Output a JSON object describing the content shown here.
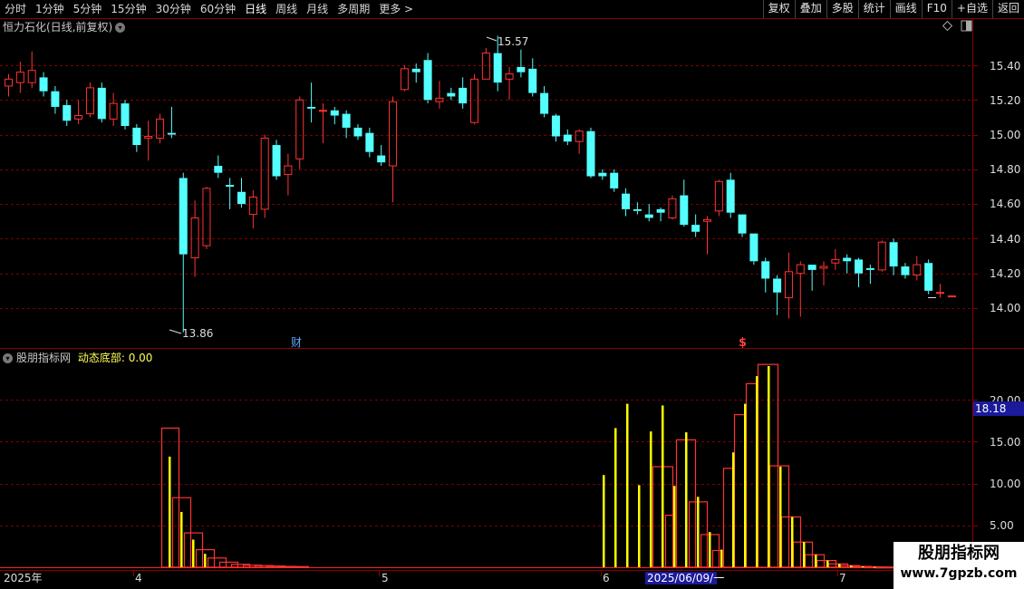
{
  "toolbar": {
    "periods": [
      "分时",
      "1分钟",
      "5分钟",
      "15分钟",
      "30分钟",
      "60分钟",
      "日线",
      "周线",
      "月线",
      "多周期",
      "更多 >"
    ],
    "active_period": "日线",
    "actions": [
      "复权",
      "叠加",
      "多股",
      "统计",
      "画线",
      "F10",
      "+自选",
      "返回"
    ]
  },
  "main_panel": {
    "title": "恒力石化(日线,前复权)",
    "y_ticks": [
      "15.40",
      "15.20",
      "15.00",
      "14.80",
      "14.60",
      "14.40",
      "14.20",
      "14.00"
    ],
    "high_label": "15.57",
    "low_label": "13.86",
    "marker_cai": "财",
    "marker_s": "$"
  },
  "sub_panel": {
    "title": "股朋指标网",
    "indicator_label": "动态底部: 0.00",
    "y_ticks": [
      "20.00",
      "15.00",
      "10.00",
      "5.00"
    ],
    "current_value": "18.18"
  },
  "date_axis": {
    "labels": [
      "2025年",
      "4",
      "5",
      "6",
      "7"
    ],
    "cursor_date": "2025/06/09/一"
  },
  "watermark": {
    "line1": "股朋指标网",
    "line2": "www.7gpzb.com"
  },
  "colors": {
    "up": "#ff3232",
    "down": "#54ffff",
    "yellow_bar": "#ffff00",
    "grid": "#7a0000",
    "axis_text": "#dddddd"
  },
  "chart_data": {
    "type": "candlestick",
    "price_range": [
      13.8,
      15.6
    ],
    "candles": [
      [
        15.28,
        15.32,
        15.35,
        15.22
      ],
      [
        15.3,
        15.36,
        15.42,
        15.24
      ],
      [
        15.3,
        15.37,
        15.48,
        15.27
      ],
      [
        15.33,
        15.25,
        15.36,
        15.22
      ],
      [
        15.25,
        15.16,
        15.28,
        15.12
      ],
      [
        15.17,
        15.08,
        15.2,
        15.05
      ],
      [
        15.09,
        15.11,
        15.2,
        15.06
      ],
      [
        15.12,
        15.27,
        15.3,
        15.1
      ],
      [
        15.27,
        15.09,
        15.3,
        15.07
      ],
      [
        15.09,
        15.18,
        15.24,
        15.05
      ],
      [
        15.18,
        15.05,
        15.2,
        15.03
      ],
      [
        15.04,
        14.94,
        15.06,
        14.9
      ],
      [
        14.98,
        14.99,
        15.08,
        14.85
      ],
      [
        14.98,
        15.09,
        15.12,
        14.95
      ],
      [
        15.01,
        15.0,
        15.16,
        14.98
      ],
      [
        14.75,
        14.31,
        14.78,
        13.86
      ],
      [
        14.29,
        14.52,
        14.62,
        14.18
      ],
      [
        14.36,
        14.69,
        14.7,
        14.34
      ],
      [
        14.82,
        14.78,
        14.88,
        14.75
      ],
      [
        14.71,
        14.7,
        14.75,
        14.57
      ],
      [
        14.67,
        14.6,
        14.75,
        14.58
      ],
      [
        14.54,
        14.64,
        14.68,
        14.46
      ],
      [
        14.57,
        14.98,
        15.0,
        14.52
      ],
      [
        14.94,
        14.76,
        14.97,
        14.74
      ],
      [
        14.77,
        14.82,
        14.89,
        14.65
      ],
      [
        14.86,
        15.2,
        15.22,
        14.8
      ],
      [
        15.16,
        15.15,
        15.3,
        15.07
      ],
      [
        15.14,
        15.14,
        15.18,
        14.95
      ],
      [
        15.14,
        15.11,
        15.16,
        15.06
      ],
      [
        15.12,
        15.04,
        15.14,
        14.98
      ],
      [
        15.04,
        14.99,
        15.06,
        14.97
      ],
      [
        15.01,
        14.9,
        15.04,
        14.87
      ],
      [
        14.88,
        14.84,
        14.94,
        14.82
      ],
      [
        14.82,
        15.19,
        15.22,
        14.61
      ],
      [
        15.26,
        15.38,
        15.4,
        15.25
      ],
      [
        15.38,
        15.36,
        15.41,
        15.3
      ],
      [
        15.43,
        15.2,
        15.47,
        15.18
      ],
      [
        15.19,
        15.21,
        15.31,
        15.15
      ],
      [
        15.24,
        15.22,
        15.27,
        15.2
      ],
      [
        15.27,
        15.18,
        15.33,
        15.15
      ],
      [
        15.07,
        15.32,
        15.35,
        15.06
      ],
      [
        15.32,
        15.47,
        15.5,
        15.32
      ],
      [
        15.47,
        15.3,
        15.57,
        15.25
      ],
      [
        15.32,
        15.35,
        15.39,
        15.2
      ],
      [
        15.39,
        15.36,
        15.49,
        15.33
      ],
      [
        15.38,
        15.24,
        15.44,
        15.22
      ],
      [
        15.24,
        15.12,
        15.28,
        15.1
      ],
      [
        15.11,
        14.99,
        15.12,
        14.96
      ],
      [
        15.0,
        14.96,
        15.03,
        14.94
      ],
      [
        14.96,
        15.02,
        15.03,
        14.89
      ],
      [
        15.02,
        14.76,
        15.04,
        14.75
      ],
      [
        14.78,
        14.76,
        14.8,
        14.74
      ],
      [
        14.78,
        14.69,
        14.8,
        14.67
      ],
      [
        14.66,
        14.57,
        14.69,
        14.53
      ],
      [
        14.57,
        14.56,
        14.61,
        14.54
      ],
      [
        14.54,
        14.52,
        14.6,
        14.5
      ],
      [
        14.57,
        14.55,
        14.58,
        14.5
      ],
      [
        14.52,
        14.63,
        14.65,
        14.51
      ],
      [
        14.65,
        14.48,
        14.74,
        14.47
      ],
      [
        14.48,
        14.44,
        14.54,
        14.41
      ],
      [
        14.5,
        14.51,
        14.53,
        14.31
      ],
      [
        14.56,
        14.73,
        14.74,
        14.53
      ],
      [
        14.74,
        14.55,
        14.78,
        14.52
      ],
      [
        14.54,
        14.43,
        14.54,
        14.41
      ],
      [
        14.43,
        14.27,
        14.43,
        14.25
      ],
      [
        14.27,
        14.17,
        14.29,
        14.09
      ],
      [
        14.17,
        14.09,
        14.19,
        13.96
      ],
      [
        14.06,
        14.21,
        14.32,
        13.94
      ],
      [
        14.2,
        14.25,
        14.27,
        13.95
      ],
      [
        14.25,
        14.22,
        14.25,
        14.1
      ],
      [
        14.23,
        14.24,
        14.27,
        14.13
      ],
      [
        14.26,
        14.28,
        14.34,
        14.22
      ],
      [
        14.29,
        14.27,
        14.31,
        14.2
      ],
      [
        14.28,
        14.2,
        14.29,
        14.12
      ],
      [
        14.23,
        14.22,
        14.25,
        14.14
      ],
      [
        14.22,
        14.38,
        14.39,
        14.21
      ],
      [
        14.38,
        14.24,
        14.4,
        14.19
      ],
      [
        14.24,
        14.19,
        14.26,
        14.17
      ],
      [
        14.19,
        14.25,
        14.3,
        14.16
      ],
      [
        14.26,
        14.1,
        14.28,
        14.08
      ],
      [
        14.09,
        14.09,
        14.14,
        14.06
      ],
      [
        14.07,
        14.07,
        14.07,
        14.07
      ]
    ],
    "sub_range": [
      0,
      25
    ],
    "boxes": [
      {
        "x0": 178,
        "x1": 197,
        "v": 16.6
      },
      {
        "x0": 190,
        "x1": 210,
        "v": 8.3
      },
      {
        "x0": 203,
        "x1": 223,
        "v": 4.1
      },
      {
        "x0": 216,
        "x1": 236,
        "v": 2.1
      },
      {
        "x0": 229,
        "x1": 249,
        "v": 1.1
      },
      {
        "x0": 242,
        "x1": 262,
        "v": 0.6
      },
      {
        "x0": 255,
        "x1": 275,
        "v": 0.35
      },
      {
        "x0": 268,
        "x1": 288,
        "v": 0.25
      },
      {
        "x0": 281,
        "x1": 301,
        "v": 0.2
      },
      {
        "x0": 294,
        "x1": 314,
        "v": 0.15
      },
      {
        "x0": 307,
        "x1": 327,
        "v": 0.1
      },
      {
        "x0": 320,
        "x1": 340,
        "v": 0.08
      },
      {
        "x0": 720,
        "x1": 742,
        "v": 12.0
      },
      {
        "x0": 734,
        "x1": 744,
        "v": 6.2
      },
      {
        "x0": 746,
        "x1": 767,
        "v": 15.2
      },
      {
        "x0": 760,
        "x1": 780,
        "v": 7.8
      },
      {
        "x0": 773,
        "x1": 793,
        "v": 3.9
      },
      {
        "x0": 786,
        "x1": 796,
        "v": 2.0
      },
      {
        "x0": 798,
        "x1": 808,
        "v": 11.8
      },
      {
        "x0": 810,
        "x1": 822,
        "v": 18.2
      },
      {
        "x0": 823,
        "x1": 835,
        "v": 21.9
      },
      {
        "x0": 836,
        "x1": 858,
        "v": 24.2
      },
      {
        "x0": 849,
        "x1": 870,
        "v": 12.1
      },
      {
        "x0": 862,
        "x1": 883,
        "v": 6.0
      },
      {
        "x0": 875,
        "x1": 896,
        "v": 3.0
      },
      {
        "x0": 888,
        "x1": 909,
        "v": 1.5
      },
      {
        "x0": 901,
        "x1": 922,
        "v": 0.8
      },
      {
        "x0": 914,
        "x1": 935,
        "v": 0.4
      },
      {
        "x0": 927,
        "x1": 948,
        "v": 0.2
      },
      {
        "x0": 940,
        "x1": 961,
        "v": 0.1
      },
      {
        "x0": 953,
        "x1": 974,
        "v": 0.05
      },
      {
        "x0": 966,
        "x1": 987,
        "v": 0.03
      }
    ],
    "ybars": [
      {
        "x": 187,
        "v": 13.2
      },
      {
        "x": 200,
        "v": 6.6
      },
      {
        "x": 213,
        "v": 3.3
      },
      {
        "x": 226,
        "v": 1.6
      },
      {
        "x": 666,
        "v": 11.0
      },
      {
        "x": 679,
        "v": 16.6
      },
      {
        "x": 692,
        "v": 19.5
      },
      {
        "x": 705,
        "v": 9.8
      },
      {
        "x": 718,
        "v": 16.2
      },
      {
        "x": 731,
        "v": 19.3
      },
      {
        "x": 744,
        "v": 9.7
      },
      {
        "x": 757,
        "v": 16.1
      },
      {
        "x": 770,
        "v": 8.4
      },
      {
        "x": 783,
        "v": 4.2
      },
      {
        "x": 796,
        "v": 2.1
      },
      {
        "x": 809,
        "v": 13.7
      },
      {
        "x": 822,
        "v": 19.5
      },
      {
        "x": 835,
        "v": 22.8
      },
      {
        "x": 848,
        "v": 24.0
      },
      {
        "x": 861,
        "v": 12.0
      },
      {
        "x": 874,
        "v": 6.0
      },
      {
        "x": 887,
        "v": 3.0
      },
      {
        "x": 900,
        "v": 1.5
      },
      {
        "x": 913,
        "v": 0.8
      },
      {
        "x": 926,
        "v": 0.4
      },
      {
        "x": 939,
        "v": 0.2
      },
      {
        "x": 952,
        "v": 0.1
      },
      {
        "x": 965,
        "v": 0.05
      }
    ]
  }
}
